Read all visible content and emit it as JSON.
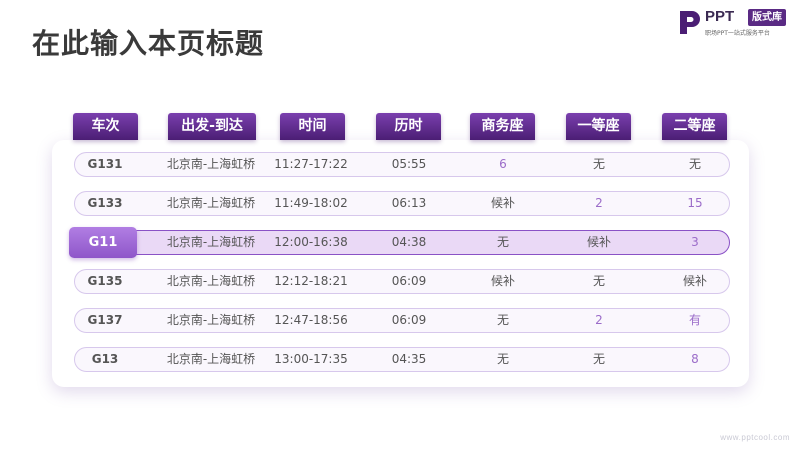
{
  "page": {
    "title": "在此输入本页标题"
  },
  "logo": {
    "brand": "PPT",
    "badge": "版式库",
    "tagline": "职场PPT一站式服务平台"
  },
  "watermark": "www.pptcool.com",
  "colors": {
    "accent": "#5a2a84",
    "highlight_row": "#ead9f6",
    "highlight_tab": "#a36fd8",
    "purple_text": "#9b6cc9"
  },
  "table": {
    "headers": [
      "车次",
      "出发-到达",
      "时间",
      "历时",
      "商务座",
      "一等座",
      "二等座"
    ],
    "highlighted_row": 2,
    "rows": [
      {
        "train": "G131",
        "route": "北京南-上海虹桥",
        "time": "11:27-17:22",
        "duration": "05:55",
        "business": "6",
        "first": "无",
        "second": "无"
      },
      {
        "train": "G133",
        "route": "北京南-上海虹桥",
        "time": "11:49-18:02",
        "duration": "06:13",
        "business": "候补",
        "first": "2",
        "second": "15"
      },
      {
        "train": "G11",
        "route": "北京南-上海虹桥",
        "time": "12:00-16:38",
        "duration": "04:38",
        "business": "无",
        "first": "候补",
        "second": "3"
      },
      {
        "train": "G135",
        "route": "北京南-上海虹桥",
        "time": "12:12-18:21",
        "duration": "06:09",
        "business": "候补",
        "first": "无",
        "second": "候补"
      },
      {
        "train": "G137",
        "route": "北京南-上海虹桥",
        "time": "12:47-18:56",
        "duration": "06:09",
        "business": "无",
        "first": "2",
        "second": "有"
      },
      {
        "train": "G13",
        "route": "北京南-上海虹桥",
        "time": "13:00-17:35",
        "duration": "04:35",
        "business": "无",
        "first": "无",
        "second": "8"
      }
    ]
  }
}
